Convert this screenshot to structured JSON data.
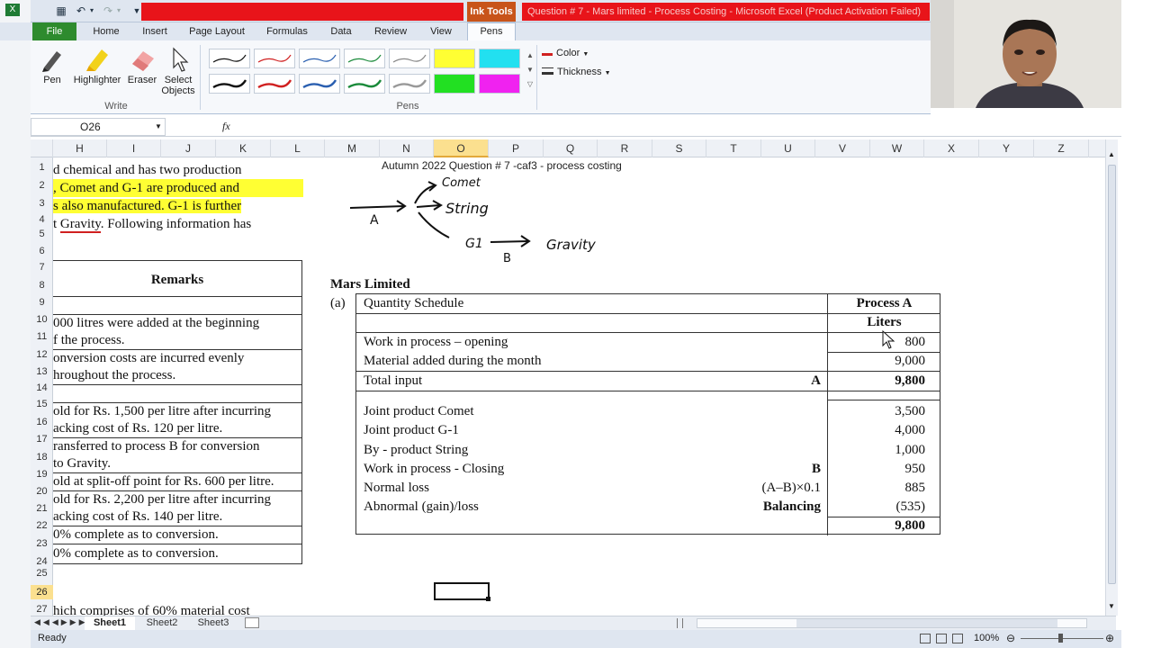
{
  "window": {
    "title": "Question # 7 - Mars limited - Process Costing - Microsoft Excel (Product Activation Failed)",
    "ink_tools": "Ink Tools"
  },
  "tabs": [
    "File",
    "Home",
    "Insert",
    "Page Layout",
    "Formulas",
    "Data",
    "Review",
    "View",
    "Pens"
  ],
  "ribbon": {
    "write_group": "Write",
    "pens_group": "Pens",
    "pen": "Pen",
    "highlighter": "Highlighter",
    "eraser": "Eraser",
    "select_objects_1": "Select",
    "select_objects_2": "Objects",
    "color": "Color",
    "thickness": "Thickness"
  },
  "formula_bar": {
    "name_box": "O26",
    "fx": "fx",
    "value": ""
  },
  "columns": [
    "H",
    "I",
    "J",
    "K",
    "L",
    "M",
    "N",
    "O",
    "P",
    "Q",
    "R",
    "S",
    "T",
    "U",
    "V",
    "W",
    "X",
    "Y",
    "Z"
  ],
  "selected_column": "O",
  "rows": [
    "1",
    "2",
    "3",
    "4",
    "5",
    "6",
    "7",
    "8",
    "9",
    "10",
    "11",
    "12",
    "13",
    "14",
    "15",
    "16",
    "17",
    "18",
    "19",
    "20",
    "21",
    "22",
    "23",
    "24",
    "25",
    "26",
    "27"
  ],
  "selected_row": "26",
  "left_text": {
    "l1": "d chemical and has two production",
    "l2": ", Comet and G-1 are produced and",
    "l3": "s also manufactured. G-1 is further",
    "l4a": "t ",
    "l4b": "Gravity",
    "l4c": ". Following information has",
    "remarks_header": "Remarks",
    "r1a": "000 litres were added at the beginning",
    "r1b": "f the process.",
    "r2a": "onversion costs are incurred evenly",
    "r2b": "hroughout the process.",
    "r3a": "old for Rs. 1,500 per litre after incurring",
    "r3b": "acking cost of Rs. 120 per litre.",
    "r4a": "ransferred to process B for conversion",
    "r4b": "to Gravity.",
    "r5": "old at split-off point for Rs. 600 per litre.",
    "r6a": "old for Rs. 2,200 per litre after incurring",
    "r6b": "acking cost of Rs. 140 per litre.",
    "r7": "0% complete as to conversion.",
    "r8": "0% complete as to conversion.",
    "bottom": "hich comprises of 60% material cost"
  },
  "caption": "Autumn 2022 Question # 7 -caf3 - process costing",
  "ink": {
    "a": "A",
    "comet": "Comet",
    "string": "String",
    "g1": "G1",
    "b": "B",
    "gravity": "Gravity"
  },
  "schedule": {
    "company": "Mars Limited",
    "part": "(a)",
    "heading": "Quantity Schedule",
    "col_title": "Process A",
    "col_unit": "Liters",
    "rows": [
      {
        "label": "Work in process – opening",
        "tag": "",
        "value": "800"
      },
      {
        "label": "Material added during the month",
        "tag": "",
        "value": "9,000"
      },
      {
        "label": "Total input",
        "tag": "A",
        "value": "9,800"
      },
      {
        "label": "Joint product Comet",
        "tag": "",
        "value": "3,500"
      },
      {
        "label": "Joint product G-1",
        "tag": "",
        "value": "4,000"
      },
      {
        "label": "By - product String",
        "tag": "",
        "value": "1,000"
      },
      {
        "label": "Work in process - Closing",
        "tag": "B",
        "value": "950"
      },
      {
        "label": "Normal loss",
        "tag": "(A–B)×0.1",
        "value": "885"
      },
      {
        "label": "Abnormal (gain)/loss",
        "tag": "Balancing",
        "value": "(535)"
      }
    ],
    "total": "9,800"
  },
  "sheets": [
    "Sheet1",
    "Sheet2",
    "Sheet3"
  ],
  "status": {
    "ready": "Ready",
    "zoom": "100%"
  },
  "colors": {
    "accent_green": "#2e8b2e",
    "title_red": "#e8141a",
    "ink_tools": "#c8541a",
    "highlight": "#ffff33",
    "selection": "#fbe08f"
  }
}
